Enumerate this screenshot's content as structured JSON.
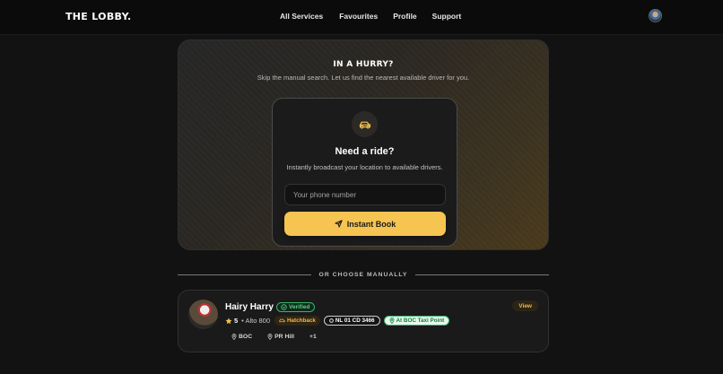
{
  "header": {
    "brand": "THE LOBBY.",
    "nav": [
      "All Services",
      "Favourites",
      "Profile",
      "Support"
    ]
  },
  "hero": {
    "title": "IN A HURRY?",
    "subtitle": "Skip the manual search. Let us find the nearest available driver for you.",
    "card": {
      "title": "Need a ride?",
      "subtitle": "Instantly broadcast your location to available drivers.",
      "phone_placeholder": "Your phone number",
      "phone_value": "",
      "button_label": "Instant Book"
    }
  },
  "divider": {
    "label": "OR CHOOSE MANUALLY"
  },
  "driver": {
    "name": "Hairy Harry",
    "verified_label": "Verified",
    "rating": "5",
    "model": "• Alto 800",
    "type": "Hatchback",
    "plate": "NL 01 CD 3466",
    "location_status": "At BOC Taxi Point",
    "view_label": "View",
    "stops": [
      "BOC",
      "PR Hill"
    ],
    "more_stops": "+1"
  },
  "colors": {
    "accent": "#f6c451",
    "verified_green": "#3ab36a",
    "background": "#121212"
  }
}
